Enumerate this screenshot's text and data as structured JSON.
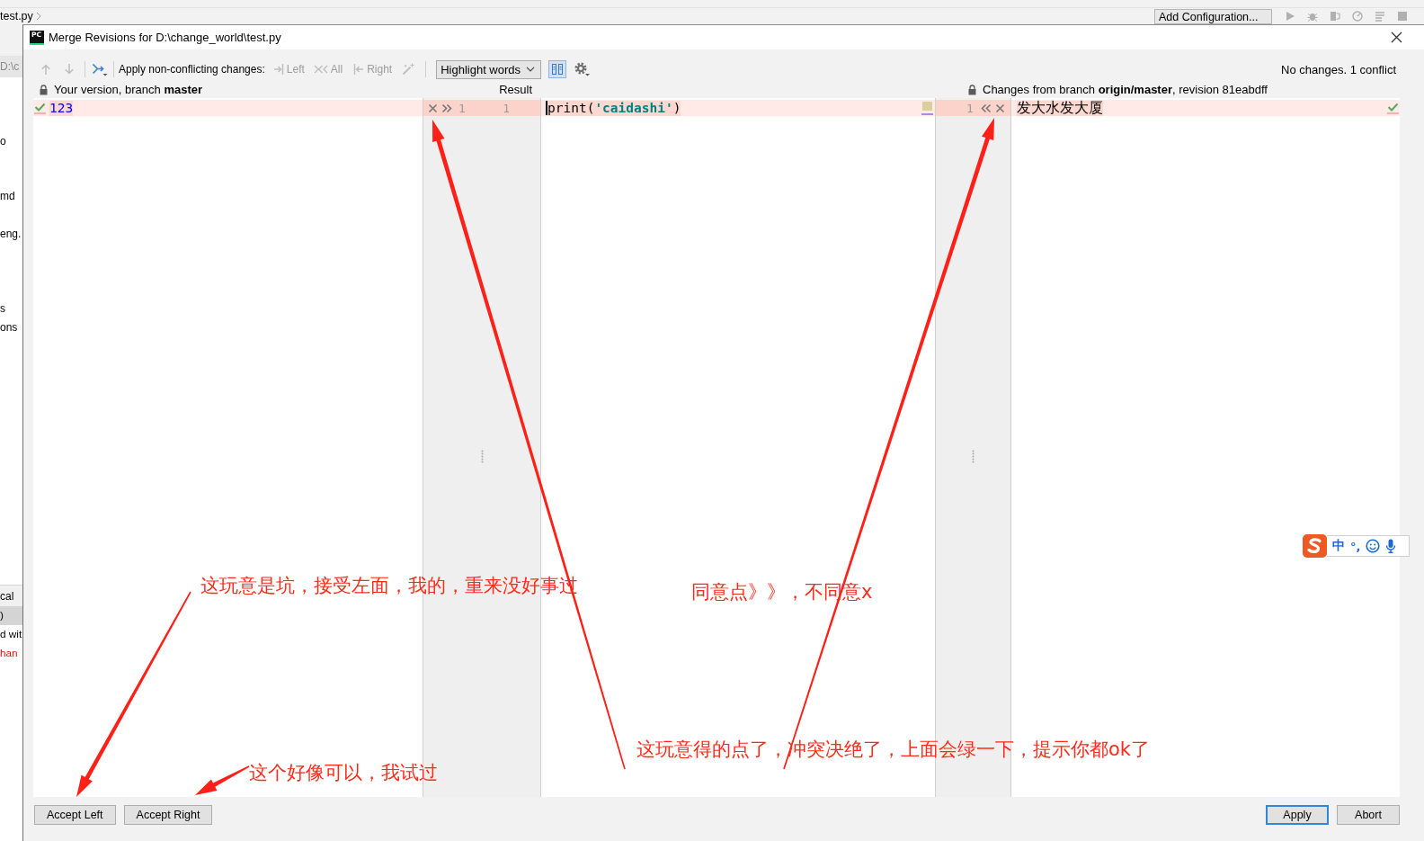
{
  "ide": {
    "breadcrumb": "test.py",
    "run_configuration": "Add Configuration...",
    "project_panel": {
      "path": "D:\\c",
      "items": [
        {
          "text": "o"
        },
        {
          "text": "md"
        },
        {
          "text": "eng."
        },
        {
          "text": "s"
        },
        {
          "text": "ons"
        }
      ]
    },
    "changes_panel": {
      "title": "cal",
      "items": [
        {
          "text": ")",
          "selected": true,
          "unversioned": false
        },
        {
          "text": "d wit",
          "selected": false,
          "unversioned": false
        },
        {
          "text": "han",
          "selected": false,
          "unversioned": true
        }
      ]
    }
  },
  "dialog": {
    "logo": "PC",
    "title": "Merge Revisions for D:\\change_world\\test.py",
    "toolbar": {
      "navigation": [
        {
          "kind": "previous",
          "disabled": true
        },
        {
          "kind": "next",
          "disabled": true
        },
        {
          "kind": "resolve",
          "disabled": false
        }
      ],
      "apply_label": "Apply non-conflicting changes:",
      "apply_actions": [
        {
          "kind": "left",
          "label": "Left",
          "disabled": true
        },
        {
          "kind": "all",
          "label": "All",
          "disabled": true
        },
        {
          "kind": "right",
          "label": "Right",
          "disabled": true
        },
        {
          "kind": "wand",
          "disabled": true
        }
      ],
      "highlight_mode": "Highlight words",
      "side_by_side": {
        "on": true
      },
      "status": "No changes. 1 conflict"
    },
    "left": {
      "header": "Your version, branch **master**",
      "lines": [
        {
          "number": "1",
          "text": "123",
          "kind": "number",
          "conflict": true,
          "checked": true
        }
      ]
    },
    "result": {
      "header": "Result",
      "lines": [
        {
          "number": "1",
          "text": "print(**'caidashi'**)",
          "kind": "code",
          "conflict": true,
          "cursor": true
        }
      ]
    },
    "right": {
      "header": "Changes from branch **origin/master**, revision 81eabdff",
      "lines": [
        {
          "number": "1",
          "text": "发大水发大厦",
          "kind": "text",
          "conflict": true,
          "checked": true
        }
      ]
    },
    "buttons_left": [
      {
        "label": "Accept Left"
      },
      {
        "label": "Accept Right"
      }
    ],
    "buttons_right": [
      {
        "label": "Apply",
        "default": true
      },
      {
        "label": "Abort",
        "default": false
      }
    ]
  },
  "ime": {
    "mode": "中",
    "punctuation": "°,"
  },
  "annotations": [
    {
      "text": "这玩意是坑，接受左面，我的，重来没好事过"
    },
    {
      "text": "这个好像可以，我试过"
    },
    {
      "text": "同意点》》，不同意x"
    },
    {
      "text": "这玩意得的点了，冲突决绝了，上面会绿一下，提示你都ok了"
    }
  ]
}
